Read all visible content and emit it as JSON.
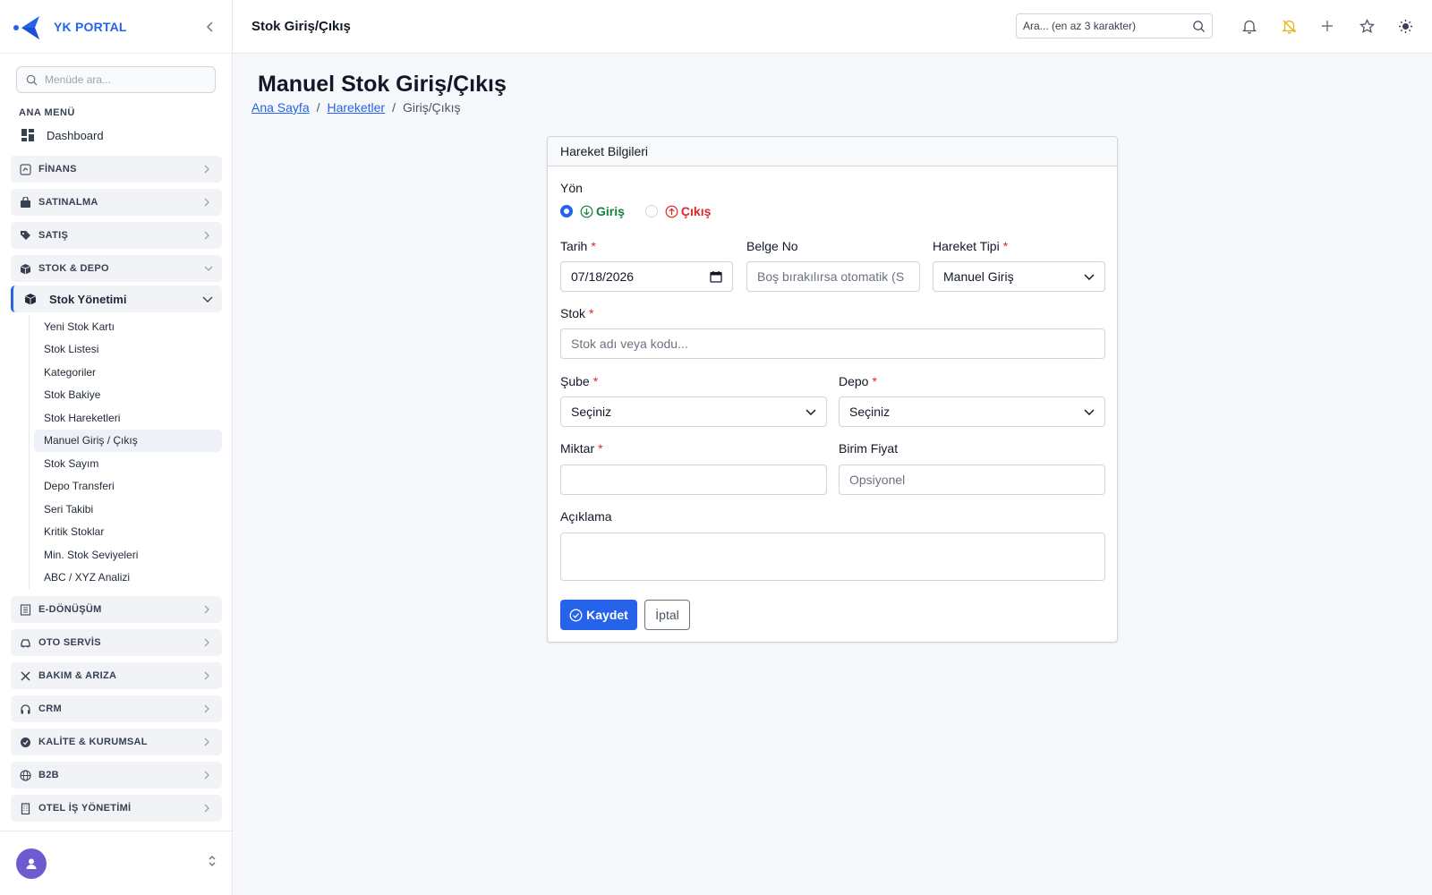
{
  "brand": {
    "name": "YK PORTAL"
  },
  "sidebar": {
    "search_placeholder": "Menüde ara...",
    "section_title": "ANA MENÜ",
    "dashboard": "Dashboard",
    "groups_top": [
      {
        "label": "FİNANS",
        "icon": "finance-icon"
      },
      {
        "label": "SATINALMA",
        "icon": "bag-icon"
      },
      {
        "label": "SATIŞ",
        "icon": "tag-icon"
      },
      {
        "label": "STOK & DEPO",
        "icon": "box-icon"
      }
    ],
    "stock_module": {
      "label": "Stok Yönetimi",
      "items": [
        "Yeni Stok Kartı",
        "Stok Listesi",
        "Kategoriler",
        "Stok Bakiye",
        "Stok Hareketleri",
        "Manuel Giriş / Çıkış",
        "Stok Sayım",
        "Depo Transferi",
        "Seri Takibi",
        "Kritik Stoklar",
        "Min. Stok Seviyeleri",
        "ABC / XYZ Analizi"
      ],
      "active_index": 5
    },
    "groups_bottom": [
      {
        "label": "E-DÖNÜŞÜM",
        "icon": "document-icon"
      },
      {
        "label": "OTO SERVİS",
        "icon": "car-icon"
      },
      {
        "label": "BAKIM & ARIZA",
        "icon": "tools-icon"
      },
      {
        "label": "CRM",
        "icon": "headset-icon"
      },
      {
        "label": "KALİTE & KURUMSAL",
        "icon": "badge-icon"
      },
      {
        "label": "B2B",
        "icon": "globe-icon"
      },
      {
        "label": "OTEL İŞ YÖNETİMİ",
        "icon": "building-icon"
      }
    ]
  },
  "header": {
    "title": "Stok Giriş/Çıkış",
    "search_placeholder": "Ara... (en az 3 karakter)"
  },
  "page": {
    "title": "Manuel Stok Giriş/Çıkış",
    "breadcrumb": {
      "home": "Ana Sayfa",
      "parent": "Hareketler",
      "current": "Giriş/Çıkış",
      "sep": "/"
    }
  },
  "form": {
    "card_title": "Hareket Bilgileri",
    "direction_label": "Yön",
    "direction_in": "Giriş",
    "direction_out": "Çıkış",
    "date_label": "Tarih",
    "date_value": "07/18/2026",
    "doc_label": "Belge No",
    "doc_placeholder": "Boş bırakılırsa otomatik (S",
    "type_label": "Hareket Tipi",
    "type_value": "Manuel Giriş",
    "stock_label": "Stok",
    "stock_placeholder": "Stok adı veya kodu...",
    "branch_label": "Şube",
    "branch_value": "Seçiniz",
    "warehouse_label": "Depo",
    "warehouse_value": "Seçiniz",
    "qty_label": "Miktar",
    "qty_value": "",
    "price_label": "Birim Fiyat",
    "price_placeholder": "Opsiyonel",
    "desc_label": "Açıklama",
    "desc_value": "",
    "required_mark": "*",
    "save_label": "Kaydet",
    "cancel_label": "İptal"
  },
  "colors": {
    "accent": "#2563eb",
    "in": "#15803d",
    "out": "#dc2626",
    "notify_off": "#eab308",
    "avatar": "#6d5bd0"
  }
}
